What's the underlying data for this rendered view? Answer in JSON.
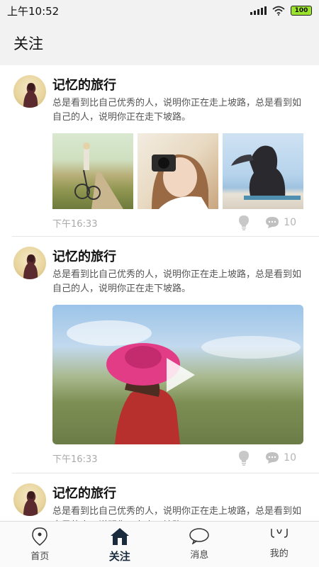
{
  "status_bar": {
    "time": "上午10:52",
    "battery": "100"
  },
  "header": {
    "title": "关注"
  },
  "posts": [
    {
      "title": "记忆的旅行",
      "text": "总是看到比自己优秀的人，说明你正在走上坡路，总是看到如自己的人，说明你正在走下坡路。",
      "media_type": "images",
      "time": "下午16:33",
      "comments": "10"
    },
    {
      "title": "记忆的旅行",
      "text": "总是看到比自己优秀的人，说明你正在走上坡路，总是看到如自己的人，说明你正在走下坡路。",
      "media_type": "video",
      "time": "下午16:33",
      "comments": "10"
    },
    {
      "title": "记忆的旅行",
      "text": "总是看到比自己优秀的人，说明你正在走上坡路，总是看到如自己的人，说明你正在走下坡路。"
    }
  ],
  "bottom_nav": {
    "items": [
      {
        "label": "首页",
        "icon": "location-pin-icon"
      },
      {
        "label": "关注",
        "icon": "house-icon"
      },
      {
        "label": "消息",
        "icon": "chat-bubble-icon"
      },
      {
        "label": "我的",
        "icon": "profile-face-icon"
      }
    ],
    "active_index": 1
  },
  "colors": {
    "active": "#1a2b3d",
    "muted": "#b5b5b5",
    "header_bg": "#f2f2f2"
  }
}
